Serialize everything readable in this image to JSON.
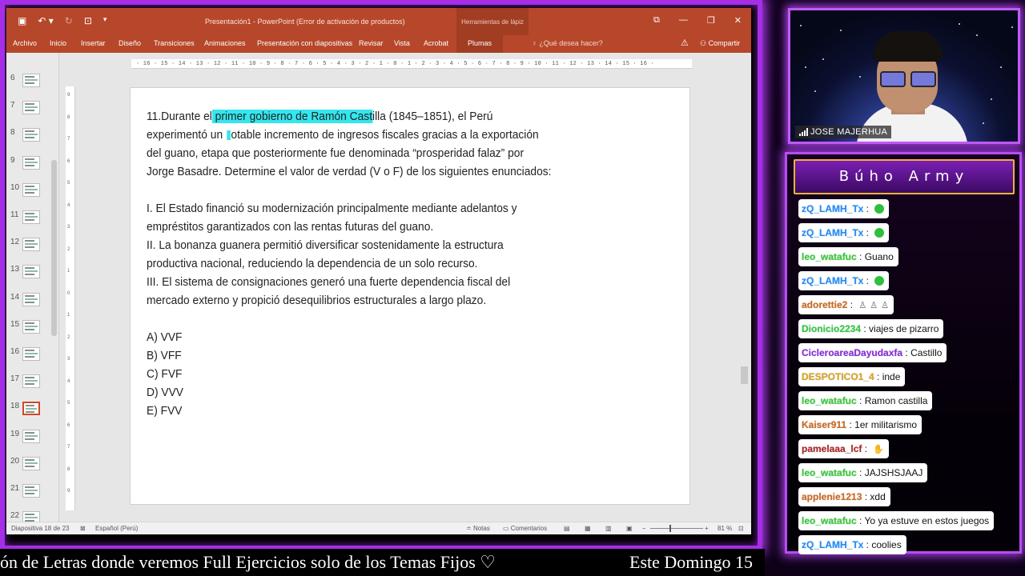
{
  "ppt": {
    "doc_title": "Presentación1 - PowerPoint (Error de activación de productos)",
    "context_group": "Herramientas de lápiz",
    "tabs": [
      "Archivo",
      "Inicio",
      "Insertar",
      "Diseño",
      "Transiciones",
      "Animaciones",
      "Presentación con diapositivas",
      "Revisar",
      "Vista",
      "Acrobat"
    ],
    "context_tab": "Plumas",
    "tell_me": "¿Qué desea hacer?",
    "share": "Compartir",
    "ruler_h": "· 16 · 15 · 14 · 13 · 12 · 11 · 10 · 9 · 8 · 7 · 6 · 5 · 4 · 3 · 2 · 1 · 0 · 1 · 2 · 3 · 4 · 5 · 6 · 7 · 8 · 9 · 10 · 11 · 12 · 13 · 14 · 15 · 16 ·",
    "ruler_v": [
      "9",
      "8",
      "7",
      "6",
      "5",
      "4",
      "3",
      "2",
      "1",
      "0",
      "1",
      "2",
      "3",
      "4",
      "5",
      "6",
      "7",
      "8",
      "9"
    ],
    "thumbnails": [
      {
        "num": "6"
      },
      {
        "num": "7"
      },
      {
        "num": "8"
      },
      {
        "num": "9"
      },
      {
        "num": "10"
      },
      {
        "num": "11"
      },
      {
        "num": "12"
      },
      {
        "num": "13"
      },
      {
        "num": "14"
      },
      {
        "num": "15"
      },
      {
        "num": "16"
      },
      {
        "num": "17"
      },
      {
        "num": "18",
        "selected": true
      },
      {
        "num": "19"
      },
      {
        "num": "20"
      },
      {
        "num": "21"
      },
      {
        "num": "22"
      }
    ],
    "slide": {
      "q_pre": "11.Durante el",
      "q_highlight": " primer gobierno de Ramón Cast",
      "q_post": "illa (1845–1851), el Perú",
      "line2_pre": "experimentó un ",
      "line2_post": "otable incremento de ingresos fiscales gracias a la exportación",
      "line3": "del guano, etapa que posteriormente fue denominada “prosperidad falaz” por",
      "line4": "Jorge Basadre. Determine el valor de verdad (V o F) de los siguientes enunciados:",
      "s1a": "I. El Estado financió su modernización principalmente mediante adelantos y",
      "s1b": "empréstitos garantizados con las rentas futuras del guano.",
      "s2a": "II. La bonanza guanera permitió diversificar sostenidamente la estructura",
      "s2b": "productiva nacional, reduciendo la dependencia de un solo recurso.",
      "s3a": "III. El sistema de consignaciones generó una fuerte dependencia fiscal del",
      "s3b": "mercado externo y propició desequilibrios estructurales a largo plazo.",
      "options": [
        "A) VVF",
        "B) VFF",
        "C) FVF",
        "D) VVV",
        "E) FVV"
      ]
    },
    "status": {
      "slide_count": "Diapositiva 18 de 23",
      "language": "Español (Perú)",
      "notes": "Notas",
      "comments": "Comentarios",
      "zoom": "81 %"
    }
  },
  "webcam": {
    "name": "JOSE MAJERHUA"
  },
  "chat": {
    "title": "Búho Army",
    "messages": [
      {
        "user": "zQ_LAMH_Tx",
        "color": "#1e90ff",
        "text": "",
        "emote": "green-face"
      },
      {
        "user": "zQ_LAMH_Tx",
        "color": "#1e90ff",
        "text": "",
        "emote": "green-face"
      },
      {
        "user": "leo_watafuc",
        "color": "#32cd32",
        "text": "Guano"
      },
      {
        "user": "zQ_LAMH_Tx",
        "color": "#1e90ff",
        "text": "",
        "emote": "green-face"
      },
      {
        "user": "adorettie2",
        "color": "#d2691e",
        "text": "",
        "emote": "figures"
      },
      {
        "user": "Dionicio2234",
        "color": "#2ecc40",
        "text": "viajes de pizarro"
      },
      {
        "user": "CicleroareaDayudaxfa",
        "color": "#8a2be2",
        "text": "Castillo"
      },
      {
        "user": "DESPOTICO1_4",
        "color": "#daa520",
        "text": "inde"
      },
      {
        "user": "leo_watafuc",
        "color": "#32cd32",
        "text": "Ramon castilla"
      },
      {
        "user": "Kaiser911",
        "color": "#d2691e",
        "text": "1er militarismo"
      },
      {
        "user": "pamelaaa_lcf",
        "color": "#b22222",
        "text": "",
        "emote": "hand"
      },
      {
        "user": "leo_watafuc",
        "color": "#32cd32",
        "text": "JAJSHSJAAJ"
      },
      {
        "user": "applenie1213",
        "color": "#d2691e",
        "text": "xdd"
      },
      {
        "user": "leo_watafuc",
        "color": "#32cd32",
        "text": "Yo ya estuve en estos juegos"
      },
      {
        "user": "zQ_LAMH_Tx",
        "color": "#1e90ff",
        "text": "coolies"
      }
    ]
  },
  "ticker": {
    "part1": "ón de Letras donde veremos Full Ejercicios solo de los Temas Fijos ♡",
    "part2": "Este Domingo 15"
  }
}
